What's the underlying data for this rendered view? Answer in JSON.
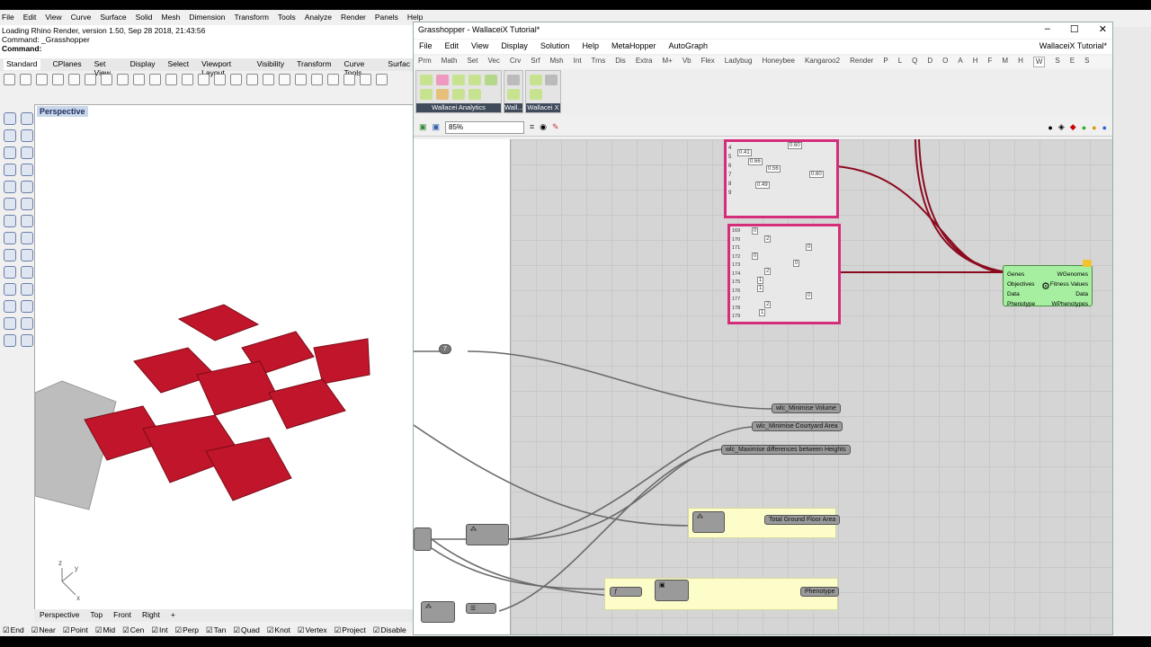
{
  "rhino": {
    "menu": [
      "File",
      "Edit",
      "View",
      "Curve",
      "Surface",
      "Solid",
      "Mesh",
      "Dimension",
      "Transform",
      "Tools",
      "Analyze",
      "Render",
      "Panels",
      "Help"
    ],
    "cmd_lines": [
      "Loading Rhino Render, version 1.50, Sep 28 2018, 21:43:56",
      "Command: _Grasshopper",
      "Command:"
    ],
    "tabs": [
      "Standard",
      "CPlanes",
      "Set View",
      "Display",
      "Select",
      "Viewport Layout",
      "Visibility",
      "Transform",
      "Curve Tools",
      "Surfac"
    ],
    "viewport_title": "Perspective",
    "viewport_tabs": [
      "Perspective",
      "Top",
      "Front",
      "Right",
      "+"
    ],
    "osnaps": [
      "End",
      "Near",
      "Point",
      "Mid",
      "Cen",
      "Int",
      "Perp",
      "Tan",
      "Quad",
      "Knot",
      "Vertex",
      "Project",
      "Disable"
    ],
    "axis_labels": {
      "z": "z",
      "y": "y",
      "x": "x"
    }
  },
  "gh": {
    "title": "Grasshopper - WallaceiX Tutorial*",
    "menu": [
      "File",
      "Edit",
      "View",
      "Display",
      "Solution",
      "Help",
      "MetaHopper",
      "AutoGraph"
    ],
    "doc_name": "WallaceiX Tutorial*",
    "tabs": [
      "Prm",
      "Math",
      "Set",
      "Vec",
      "Crv",
      "Srf",
      "Msh",
      "Int",
      "Trns",
      "Dis",
      "Extra",
      "M+",
      "Vb",
      "Flex",
      "Ladybug",
      "Honeybee",
      "Kangaroo2",
      "Render",
      "P",
      "L",
      "Q",
      "D",
      "O",
      "A",
      "H",
      "F",
      "M",
      "H",
      "W",
      "S",
      "E",
      "S"
    ],
    "ribbon_groups": [
      "Wallacei Analytics",
      "Wall...",
      "Wallacei X"
    ],
    "zoom": "85%",
    "slider_value": "7",
    "objectives": [
      "wlc_Minimise Volume",
      "wlc_Minimise Courtyard Area",
      "wlc_Maximise differences between Heights"
    ],
    "total_label": "Total Ground Floor Area",
    "phenotype_label": "Phenotype",
    "panel_top_values": [
      "0.41",
      "0.66",
      "0.56",
      "0.60",
      "0.49",
      "0.60"
    ],
    "panel_top_rows": [
      "4",
      "5",
      "6",
      "7",
      "8",
      "9"
    ],
    "panel_bottom_rows": [
      "169",
      "170",
      "171",
      "172",
      "173",
      "174",
      "175",
      "176",
      "177",
      "178",
      "179"
    ],
    "panel_bottom_values": [
      "0",
      "2",
      "0",
      "0",
      "2",
      "0",
      "1",
      "1",
      "0",
      "2",
      "1"
    ],
    "wallacei_inputs": [
      "Genes",
      "Objectives",
      "Data",
      "Phenotype"
    ],
    "wallacei_outputs": [
      "WGenomes",
      "Fitness Values",
      "Data",
      "WPhenotypes"
    ]
  },
  "colors": {
    "wire": "#8b0a1e",
    "building": "#c0152a",
    "panel_border": "#d62d7a"
  }
}
